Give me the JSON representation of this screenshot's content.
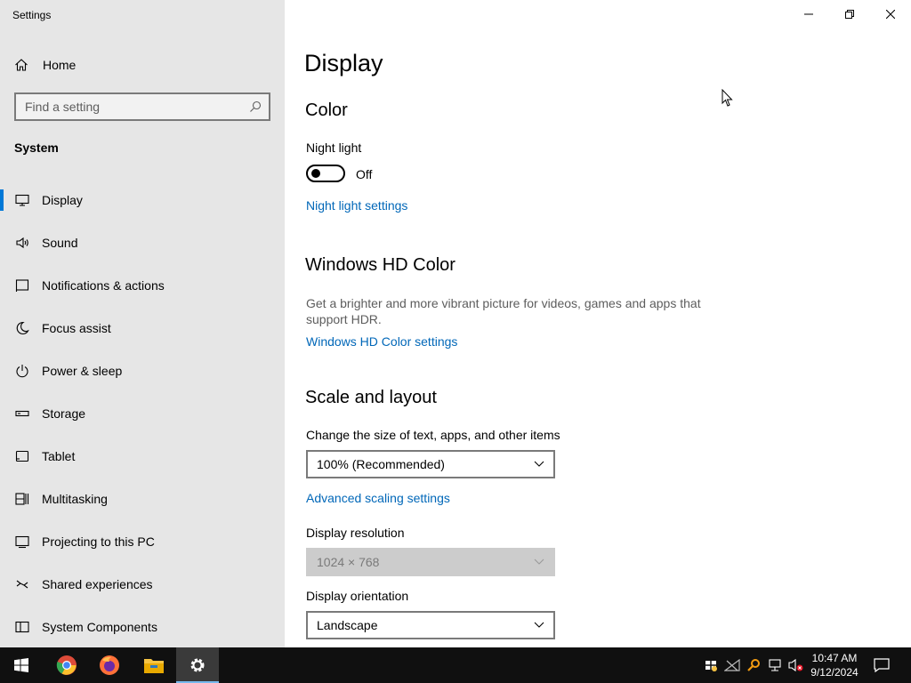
{
  "window": {
    "app_title": "Settings"
  },
  "sidebar": {
    "home_label": "Home",
    "search_placeholder": "Find a setting",
    "section_label": "System",
    "items": [
      {
        "label": "Display",
        "icon": "monitor-icon",
        "active": true
      },
      {
        "label": "Sound",
        "icon": "speaker-icon"
      },
      {
        "label": "Notifications & actions",
        "icon": "notification-icon"
      },
      {
        "label": "Focus assist",
        "icon": "moon-icon"
      },
      {
        "label": "Power & sleep",
        "icon": "power-icon"
      },
      {
        "label": "Storage",
        "icon": "storage-icon"
      },
      {
        "label": "Tablet",
        "icon": "tablet-icon"
      },
      {
        "label": "Multitasking",
        "icon": "multitasking-icon"
      },
      {
        "label": "Projecting to this PC",
        "icon": "projecting-icon"
      },
      {
        "label": "Shared experiences",
        "icon": "shared-experiences-icon"
      },
      {
        "label": "System Components",
        "icon": "system-components-icon"
      }
    ]
  },
  "main": {
    "title": "Display",
    "color_heading": "Color",
    "night_light_label": "Night light",
    "night_light_state": "Off",
    "night_light_link": "Night light settings",
    "hd_color_heading": "Windows HD Color",
    "hd_color_desc": "Get a brighter and more vibrant picture for videos, games and apps that support HDR.",
    "hd_color_link": "Windows HD Color settings",
    "scale_heading": "Scale and layout",
    "scale_label": "Change the size of text, apps, and other items",
    "scale_value": "100% (Recommended)",
    "advanced_scaling_link": "Advanced scaling settings",
    "resolution_label": "Display resolution",
    "resolution_value": "1024 × 768",
    "orientation_label": "Display orientation",
    "orientation_value": "Landscape"
  },
  "taskbar": {
    "time": "10:47 AM",
    "date": "9/12/2024",
    "pinned": [
      "windows-start-icon",
      "chrome-icon",
      "firefox-icon",
      "file-explorer-icon",
      "settings-gear-icon"
    ]
  },
  "colors": {
    "accent": "#0078d7",
    "link": "#0067b8",
    "sidebar_bg": "#e6e6e6",
    "taskbar_bg": "#101010"
  }
}
